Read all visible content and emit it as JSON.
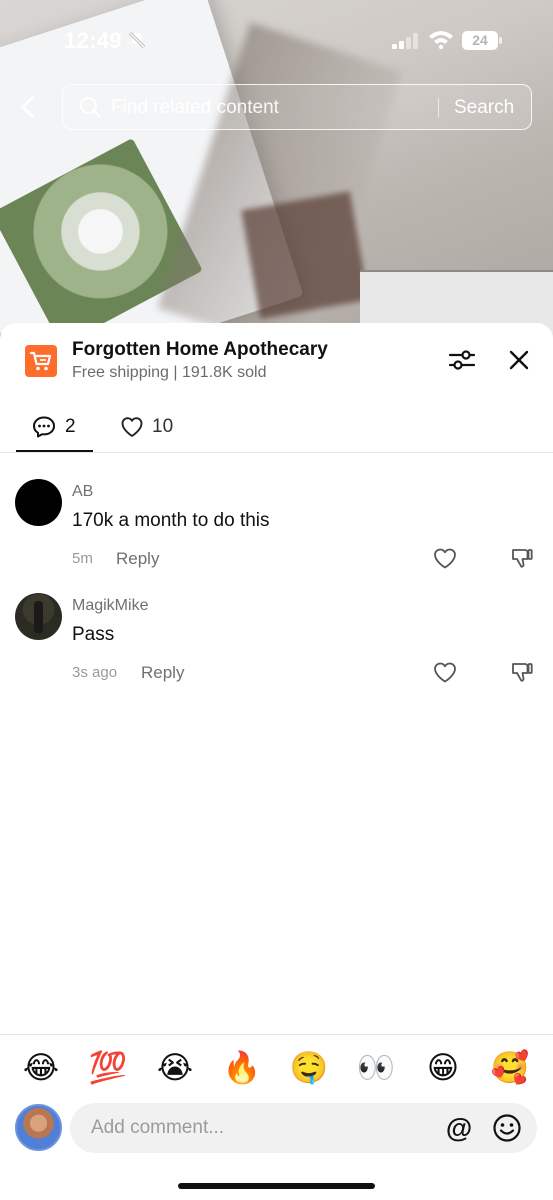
{
  "status_bar": {
    "time": "12:49",
    "battery": "24"
  },
  "search": {
    "placeholder": "Find related content",
    "button_label": "Search"
  },
  "shop": {
    "name": "Forgotten Home Apothecary",
    "subtitle": "Free shipping | 191.8K sold",
    "accent_color": "#ff6d2d"
  },
  "tabs": [
    {
      "icon": "comment-icon",
      "count": "2",
      "active": true
    },
    {
      "icon": "heart-icon",
      "count": "10",
      "active": false
    }
  ],
  "comments": [
    {
      "username": "AB",
      "text": "170k a month to do this",
      "time": "5m",
      "reply_label": "Reply"
    },
    {
      "username": "MagikMike",
      "text": "Pass",
      "time": "3s ago",
      "reply_label": "Reply"
    }
  ],
  "emoji_bar": [
    "😂",
    "💯",
    "😭",
    "🔥",
    "🤤",
    "👀",
    "😁",
    "🥰"
  ],
  "composer": {
    "placeholder": "Add comment...",
    "mention_symbol": "@"
  }
}
